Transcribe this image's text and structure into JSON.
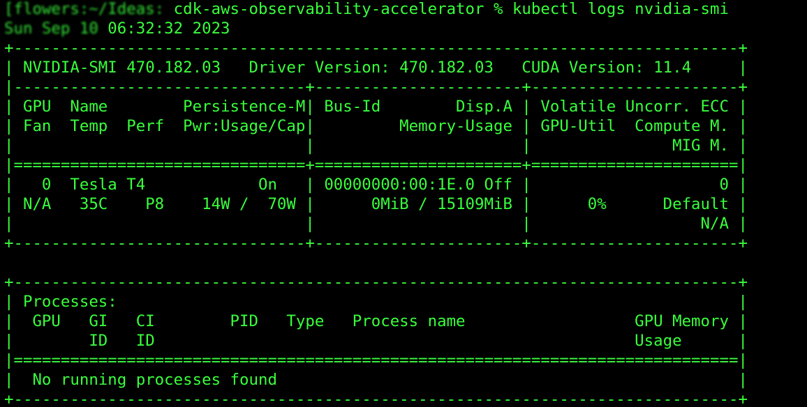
{
  "terminal": {
    "prompt_host_redacted": "[flowers:~/Ideas:",
    "prompt_cwd": " cdk-aws-observability-accelerator % kubectl logs nvidia-smi",
    "date_redacted": "Sun Sep 10",
    "date_tail": " 06:32:32 2023",
    "output_lines": [
      "+-----------------------------------------------------------------------------+",
      "| NVIDIA-SMI 470.182.03   Driver Version: 470.182.03   CUDA Version: 11.4     |",
      "|-------------------------------+----------------------+----------------------+",
      "| GPU  Name        Persistence-M| Bus-Id        Disp.A | Volatile Uncorr. ECC |",
      "| Fan  Temp  Perf  Pwr:Usage/Cap|         Memory-Usage | GPU-Util  Compute M. |",
      "|                               |                      |               MIG M. |",
      "|===============================+======================+======================|",
      "|   0  Tesla T4            On   | 00000000:00:1E.0 Off |                    0 |",
      "| N/A   35C    P8    14W /  70W |      0MiB / 15109MiB |      0%      Default |",
      "|                               |                      |                  N/A |",
      "+-------------------------------+----------------------+----------------------+",
      "",
      "+-----------------------------------------------------------------------------+",
      "| Processes:                                                                  |",
      "|  GPU   GI   CI        PID   Type   Process name                  GPU Memory |",
      "|        ID   ID                                                   Usage      |",
      "|=============================================================================|",
      "|  No running processes found                                                 |",
      "+-----------------------------------------------------------------------------+"
    ]
  }
}
